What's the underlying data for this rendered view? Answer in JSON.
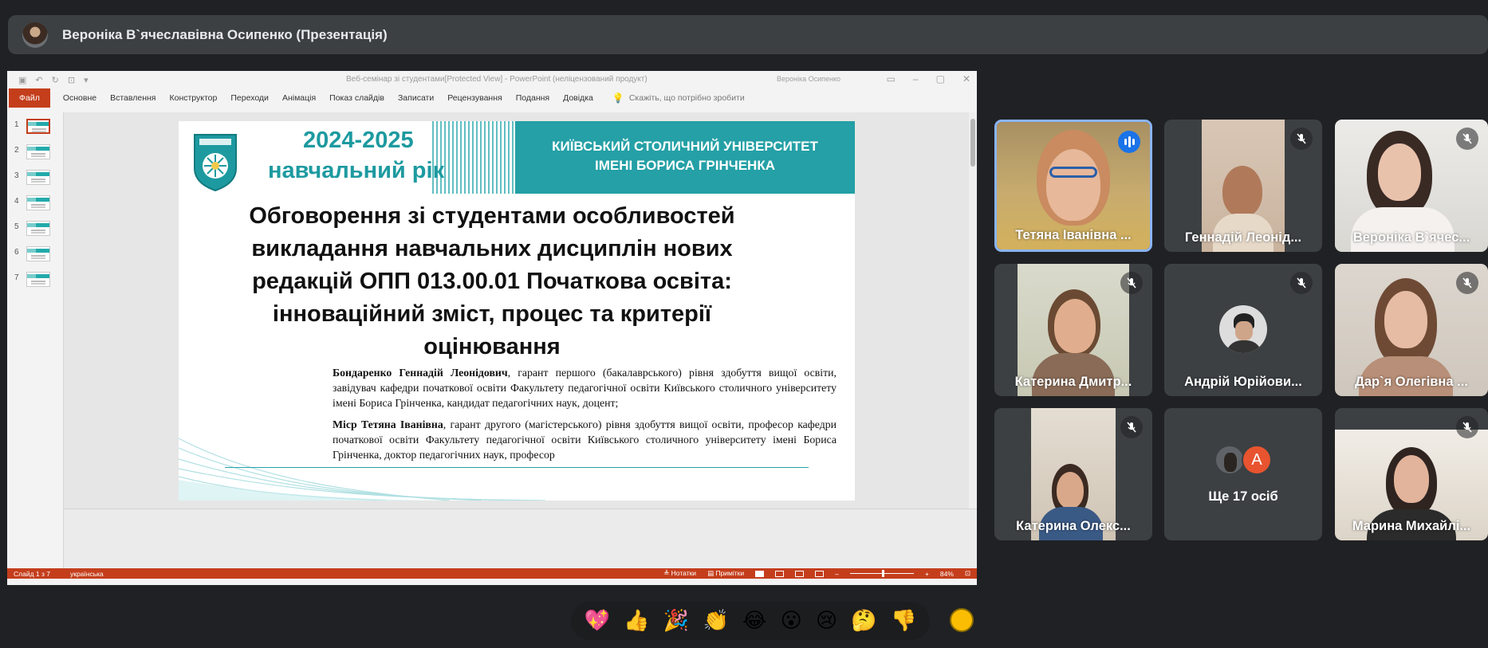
{
  "meeting": {
    "presenter_label": "Вероніка В`ячеславівна Осипенко (Презентація)",
    "more_participants": "Ще 17 осіб",
    "more_avatar_letter": "A"
  },
  "powerpoint": {
    "title": "Веб-семінар зі студентами[Protected View]  -  PowerPoint (неліцензований продукт)",
    "account": "Вероніка Осипенко",
    "ribbon_tabs": [
      "Файл",
      "Основне",
      "Вставлення",
      "Конструктор",
      "Переходи",
      "Анімація",
      "Показ слайдів",
      "Записати",
      "Рецензування",
      "Подання",
      "Довідка"
    ],
    "tell_me": "Скажіть, що потрібно зробити",
    "thumbnails": [
      "1",
      "2",
      "3",
      "4",
      "5",
      "6",
      "7"
    ],
    "status": {
      "slide": "Слайд 1 з 7",
      "language": "українська",
      "notes": "Нотатки",
      "comments": "Примітки",
      "zoom": "84%"
    }
  },
  "slide": {
    "year": "2024-2025",
    "year_label": "навчальний рік",
    "university_line1": "КИЇВСЬКИЙ СТОЛИЧНИЙ УНІВЕРСИТЕТ",
    "university_line2": "ІМЕНІ БОРИСА ГРІНЧЕНКА",
    "title": "Обговорення зі  студентами особливостей викладання навчальних дисциплін нових редакцій ОПП 013.00.01 Початкова освіта: інноваційний зміст, процес та критерії оцінювання",
    "author1_name": "Бондаренко Геннадій Леонідович",
    "author1_text": ", гарант першого (бакалаврського) рівня здобуття вищої освіти, завідувач кафедри початкової освіти Факультету педагогічної освіти Київського столичного університету імені Бориса Грінченка, кандидат педагогічних наук, доцент;",
    "author2_name": "Міср Тетяна Іванівна",
    "author2_text": ", гарант другого (магістерського) рівня здобуття вищої освіти, професор кафедри початкової освіти Факультету педагогічної освіти Київського столичного університету імені Бориса Грінченка, доктор педагогічних наук, професор"
  },
  "participants": [
    {
      "name": "Тетяна Іванівна ...",
      "state": "speaking"
    },
    {
      "name": "Геннадій Леонід...",
      "state": "muted"
    },
    {
      "name": "Вероніка В`ячес...",
      "state": "muted"
    },
    {
      "name": "Катерина Дмитр...",
      "state": "muted"
    },
    {
      "name": "Андрій Юрійови...",
      "state": "muted"
    },
    {
      "name": "Дар`я Олегівна ...",
      "state": "muted"
    },
    {
      "name": "Катерина Олекс...",
      "state": "muted"
    },
    {
      "name": "Марина Михайлі...",
      "state": "muted"
    }
  ],
  "reactions": [
    "💖",
    "👍",
    "🎉",
    "👏",
    "😂",
    "😮",
    "😢",
    "🤔",
    "👎"
  ],
  "icons": {
    "mic_off": "mic-off-icon",
    "speaking": "audio-level-icon",
    "reaction_toggle": "emoji-toggle-icon"
  },
  "colors": {
    "ppt_accent": "#c43e1c",
    "slide_teal": "#24a0a6",
    "meet_bg": "#202124",
    "tile_bg": "#3c4043",
    "speaking_border": "#8ab4f8"
  }
}
